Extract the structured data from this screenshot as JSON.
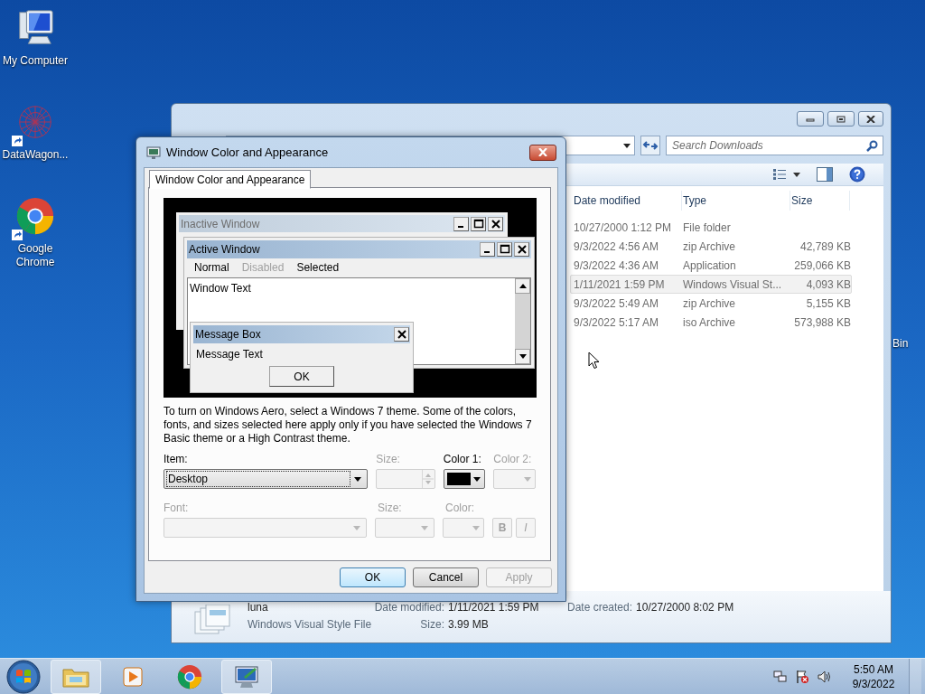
{
  "desktop_icons": [
    {
      "label": "My Computer",
      "kind": "computer",
      "shortcut": false
    },
    {
      "label": "DataWagon...",
      "kind": "datawagon",
      "shortcut": true
    },
    {
      "label": "Google Chrome",
      "kind": "chrome",
      "shortcut": true
    }
  ],
  "recycle_bin_label": "Bin",
  "explorer": {
    "search": {
      "placeholder": "Search Downloads"
    },
    "columns": [
      "Date modified",
      "Type",
      "Size"
    ],
    "rows": [
      {
        "date": "10/27/2000 1:12 PM",
        "type": "File folder",
        "size": "",
        "selected": false
      },
      {
        "date": "9/3/2022 4:56 AM",
        "type": "zip Archive",
        "size": "42,789 KB",
        "selected": false
      },
      {
        "date": "9/3/2022 4:36 AM",
        "type": "Application",
        "size": "259,066 KB",
        "selected": false
      },
      {
        "date": "1/11/2021 1:59 PM",
        "type": "Windows Visual St...",
        "size": "4,093 KB",
        "selected": true
      },
      {
        "date": "9/3/2022 5:49 AM",
        "type": "zip Archive",
        "size": "5,155 KB",
        "selected": false
      },
      {
        "date": "9/3/2022 5:17 AM",
        "type": "iso Archive",
        "size": "573,988 KB",
        "selected": false
      }
    ],
    "details": {
      "name": "luna",
      "type": "Windows Visual Style File",
      "fields": [
        {
          "label": "Date modified:",
          "value": "1/11/2021 1:59 PM"
        },
        {
          "label": "Size:",
          "value": "3.99 MB"
        }
      ],
      "created": {
        "label": "Date created:",
        "value": "10/27/2000 8:02 PM"
      }
    }
  },
  "dialog": {
    "title": "Window Color and Appearance",
    "tabs": [
      {
        "label": "Window Color and Appearance",
        "selected": true
      }
    ],
    "preview": {
      "inactive_title": "Inactive Window",
      "active_title": "Active Window",
      "menu": [
        {
          "label": "Normal",
          "kind": "normal"
        },
        {
          "label": "Disabled",
          "kind": "disabled"
        },
        {
          "label": "Selected",
          "kind": "selected"
        }
      ],
      "window_text": "Window Text",
      "message_title": "Message Box",
      "message_text": "Message Text",
      "message_button": "OK"
    },
    "note": "To turn on Windows Aero, select a Windows 7 theme.  Some of the colors, fonts, and sizes selected here apply only if you have selected the Windows 7 Basic theme or a High Contrast theme.",
    "item_row": [
      {
        "label": "Item:",
        "kind": "dropdown",
        "value": "Desktop",
        "disabled": false
      },
      {
        "label": "Size:",
        "kind": "spinner",
        "disabled": true
      },
      {
        "label": "Color 1:",
        "kind": "color",
        "color": "#000000",
        "disabled": false
      },
      {
        "label": "Color 2:",
        "kind": "color",
        "disabled": true
      }
    ],
    "font_row": [
      {
        "label": "Font:",
        "kind": "dropdown",
        "disabled": true
      },
      {
        "label": "Size:",
        "kind": "dropdown",
        "disabled": true
      },
      {
        "label": "Color:",
        "kind": "color",
        "disabled": true
      }
    ],
    "style_buttons": [
      {
        "label": "B",
        "kind": "bold",
        "disabled": true
      },
      {
        "label": "I",
        "kind": "italic",
        "disabled": true
      }
    ],
    "buttons": [
      {
        "label": "OK",
        "default": true,
        "disabled": false
      },
      {
        "label": "Cancel",
        "default": false,
        "disabled": false
      },
      {
        "label": "Apply",
        "default": false,
        "disabled": true
      }
    ]
  },
  "taskbar": {
    "items": [
      {
        "kind": "explorer",
        "open": true
      },
      {
        "kind": "media",
        "open": false
      },
      {
        "kind": "chrome",
        "open": false
      },
      {
        "kind": "display",
        "open": true
      }
    ],
    "clock": {
      "time": "5:50 AM",
      "date": "9/3/2022"
    }
  }
}
